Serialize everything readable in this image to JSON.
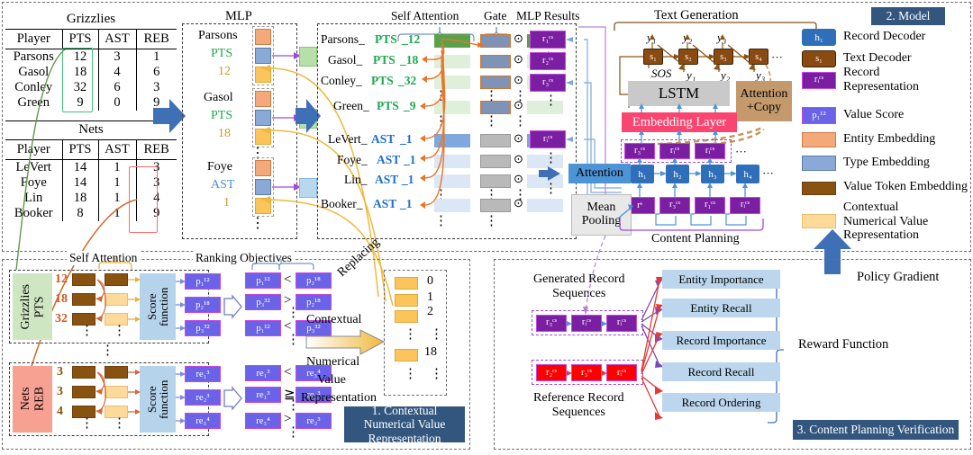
{
  "tables": [
    {
      "caption": "Grizzlies",
      "columns": [
        "Player",
        "PTS",
        "AST",
        "REB"
      ],
      "rows": [
        [
          "Parsons",
          "12",
          "3",
          "1"
        ],
        [
          "Gasol",
          "18",
          "4",
          "6"
        ],
        [
          "Conley",
          "32",
          "6",
          "3"
        ],
        [
          "Green",
          "9",
          "0",
          "9"
        ]
      ],
      "highlight_column": "PTS",
      "highlight_color": "#48c07e"
    },
    {
      "caption": "Nets",
      "columns": [
        "Player",
        "PTS",
        "AST",
        "REB"
      ],
      "rows": [
        [
          "LeVert",
          "14",
          "1",
          "3"
        ],
        [
          "Foye",
          "14",
          "1",
          "3"
        ],
        [
          "Lin",
          "18",
          "1",
          "4"
        ],
        [
          "Booker",
          "8",
          "1",
          "9"
        ]
      ],
      "highlight_column": "REB",
      "highlight_color": "#ff6a6a"
    }
  ],
  "mlp": {
    "title": "MLP",
    "entries": [
      {
        "entity": "Parsons",
        "type": "PTS",
        "value": "12",
        "type_color": "#1fa84f"
      },
      {
        "entity": "Gasol",
        "type": "PTS",
        "value": "18",
        "type_color": "#1fa84f"
      },
      {
        "entity": "Foye",
        "type": "AST",
        "value": "1",
        "type_color": "#4e8fd9"
      }
    ],
    "ellipsis": "⋮"
  },
  "self_attention_block": {
    "labels": {
      "self_attention": "Self Attention",
      "gate": "Gate",
      "mlp_results": "MLP Results"
    },
    "records": [
      {
        "entity": "Parsons_",
        "type": "PTS",
        "value": "_12",
        "group": "pts"
      },
      {
        "entity": "Gasol_",
        "type": "PTS",
        "value": "_18",
        "group": "pts"
      },
      {
        "entity": "Conley_",
        "type": "PTS",
        "value": "_32",
        "group": "pts"
      },
      {
        "entity": "Green_",
        "type": "PTS",
        "value": "_9",
        "group": "pts"
      },
      {
        "entity": "LeVert_",
        "type": "AST",
        "value": "_1",
        "group": "ast"
      },
      {
        "entity": "Foye_ ",
        "type": "AST",
        "value": " _1",
        "group": "ast"
      },
      {
        "entity": "Lin_ ",
        "type": "AST",
        "value": " _1",
        "group": "ast"
      },
      {
        "entity": "Booker_ ",
        "type": "AST",
        "value": " _1",
        "group": "ast"
      }
    ],
    "gate_symbol": "⊙",
    "results": [
      "r₁ᶜˢ",
      "r₂ᶜˢ",
      "r₃ᶜˢ",
      "rᵢᶜˢ"
    ]
  },
  "text_generation": {
    "title": "Text Generation",
    "outputs_top": [
      "y₁",
      "y₂",
      "y₃"
    ],
    "states": [
      "s₁",
      "s₂",
      "s₃",
      "s₄"
    ],
    "inputs_bottom": [
      "SOS",
      "y₁",
      "y₂",
      "y₃"
    ],
    "lstm": "LSTM",
    "embedding_layer": "Embedding Layer",
    "attention_copy": [
      "Attention",
      "+Copy"
    ],
    "ellipsis": "···"
  },
  "content_planning": {
    "title": "Content Planning",
    "attention": "Attention",
    "mean_pooling": [
      "Mean",
      "Pooling"
    ],
    "plan_top": [
      "r₃ᶜˢ",
      "rᵢᶜˢ",
      "rᵢᶜˢ"
    ],
    "decoder_states": [
      "h₁",
      "h₂",
      "h₃",
      "h₄"
    ],
    "plan_inputs": [
      "rˢ",
      "r₃ᶜˢ",
      "r₁ᶜˢ",
      "rᵢᶜˢ"
    ],
    "ellipsis": "···"
  },
  "legend": {
    "title": "2. Model",
    "items": [
      {
        "symbol": "h₁",
        "label": "Record Decoder",
        "kind": "hbox",
        "color": "#2f6fba"
      },
      {
        "symbol": "s₁",
        "label": "Text Decoder",
        "kind": "sbox",
        "color": "#8a4b12"
      },
      {
        "symbol": "rᵢᶜˢ",
        "label": "Record Representation",
        "kind": "rbox",
        "color": "#7b1fa2"
      },
      {
        "symbol": "p₁¹²",
        "label": "Value Score",
        "kind": "pbox",
        "color": "#6a63e8"
      },
      {
        "symbol": "",
        "label": "Entity Embedding",
        "kind": "swatch",
        "color": "#f4a97a"
      },
      {
        "symbol": "",
        "label": "Type Embedding",
        "kind": "swatch",
        "color": "#8ba9d6"
      },
      {
        "symbol": "",
        "label": "Value Token Embedding",
        "kind": "swatch",
        "color": "#8a5210"
      },
      {
        "symbol": "",
        "label": "Contextual Numerical Value Representation",
        "kind": "swatch",
        "color": "#fbc55b"
      }
    ]
  },
  "section1": {
    "banner": "1. Contextual Numerical Value Representation",
    "labels": {
      "self_attention": "Self Attention",
      "ranking_objectives": "Ranking Objectives",
      "replacing": "Replacing",
      "contextual_numerical_value_representation": [
        "Contextual",
        "Numerical",
        "Value",
        "Representation"
      ],
      "score_function": "Score function"
    },
    "groups": [
      {
        "entity_label": [
          "Grizzlies",
          "PTS"
        ],
        "entity_color": "#cfe6c2",
        "values": [
          "12",
          "18",
          "32"
        ],
        "value_color": "#d1561e",
        "scores": [
          "p₁¹²",
          "p₂¹⁸",
          "p₃³²"
        ],
        "ranked": [
          "p₁¹²",
          "p₃³²",
          "p₁¹²"
        ],
        "comparisons": [
          {
            "left": "p₁¹²",
            "op": "<",
            "right": "p₂¹⁸"
          },
          {
            "left": "p₃³²",
            "op": ">",
            "right": "p₂¹⁸"
          },
          {
            "left": "p₁¹²",
            "op": "<",
            "right": "p₃³²"
          }
        ]
      },
      {
        "entity_label": [
          "Nets",
          "REB"
        ],
        "entity_color": "#f6a192",
        "values": [
          "3",
          "3",
          "4"
        ],
        "value_color": "#8a5210",
        "scores": [
          "re₁³",
          "re₂³",
          "re₃⁴"
        ],
        "ranked": [
          "re₁³",
          "re₁³",
          "re₃⁴"
        ],
        "comparisons": [
          {
            "left": "re₁³",
            "op": "<",
            "right": "re₃⁴"
          },
          {
            "left": "re₁³",
            "op": "≧",
            "right": "re₂³"
          },
          {
            "left": "re₃⁴",
            "op": ">",
            "right": "re₂³"
          }
        ]
      }
    ],
    "value_table": [
      "0",
      "1",
      "2",
      "⋮",
      "18",
      "⋮"
    ]
  },
  "section3": {
    "banner": "3. Content Planning Verification",
    "generated_label": [
      "Generated Record",
      "Sequences"
    ],
    "reference_label": [
      "Reference Record",
      "Sequences"
    ],
    "generated_sequence": [
      "r₃ᶜˢ",
      "rᵢᶜˢ",
      "rᵢᶜˢ"
    ],
    "reference_sequence": [
      "r₂ᶜˢ",
      "r₃ᶜˢ",
      "rᵢᶜˢ"
    ],
    "rewards": [
      "Entity Importance",
      "Entity Recall",
      "Record Importance",
      "Record Recall",
      "Record Ordering"
    ],
    "reward_function": "Reward Function",
    "policy_gradient": "Policy Gradient"
  }
}
